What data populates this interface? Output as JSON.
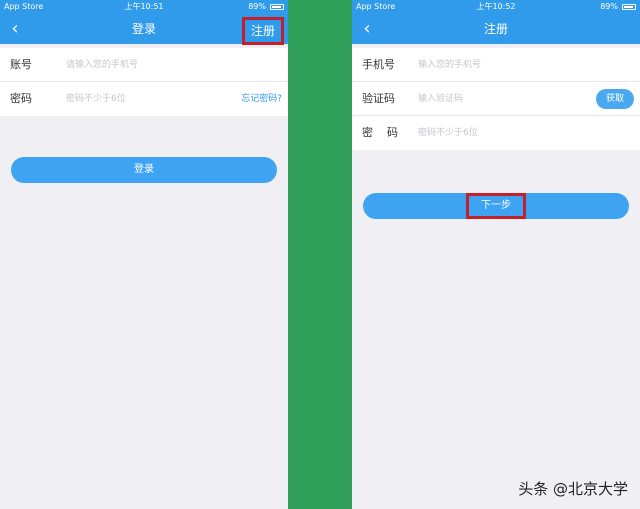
{
  "left": {
    "status": {
      "carrier": "App Store",
      "time": "上午10:51",
      "battery": "89%"
    },
    "nav": {
      "back": "‹",
      "title": "登录",
      "right_action": "注册"
    },
    "fields": [
      {
        "label": "账号",
        "placeholder": "请输入您的手机号"
      },
      {
        "label": "密码",
        "placeholder": "密码不少于6位",
        "link": "忘记密码?"
      }
    ],
    "login_button": "登录"
  },
  "right": {
    "status": {
      "carrier": "App Store",
      "time": "上午10:52",
      "battery": "89%"
    },
    "nav": {
      "back": "‹",
      "title": "注册"
    },
    "fields": [
      {
        "label": "手机号",
        "placeholder": "输入您的手机号"
      },
      {
        "label": "验证码",
        "placeholder": "输入验证码",
        "button": "获取"
      },
      {
        "label": "密    码",
        "placeholder": "密码不少于6位"
      }
    ],
    "next_button": "下一步"
  },
  "watermark": "头条 @北京大学",
  "colors": {
    "primary": "#2f9bea",
    "highlight": "#c4202c",
    "divider_green": "#2f9f5a"
  }
}
